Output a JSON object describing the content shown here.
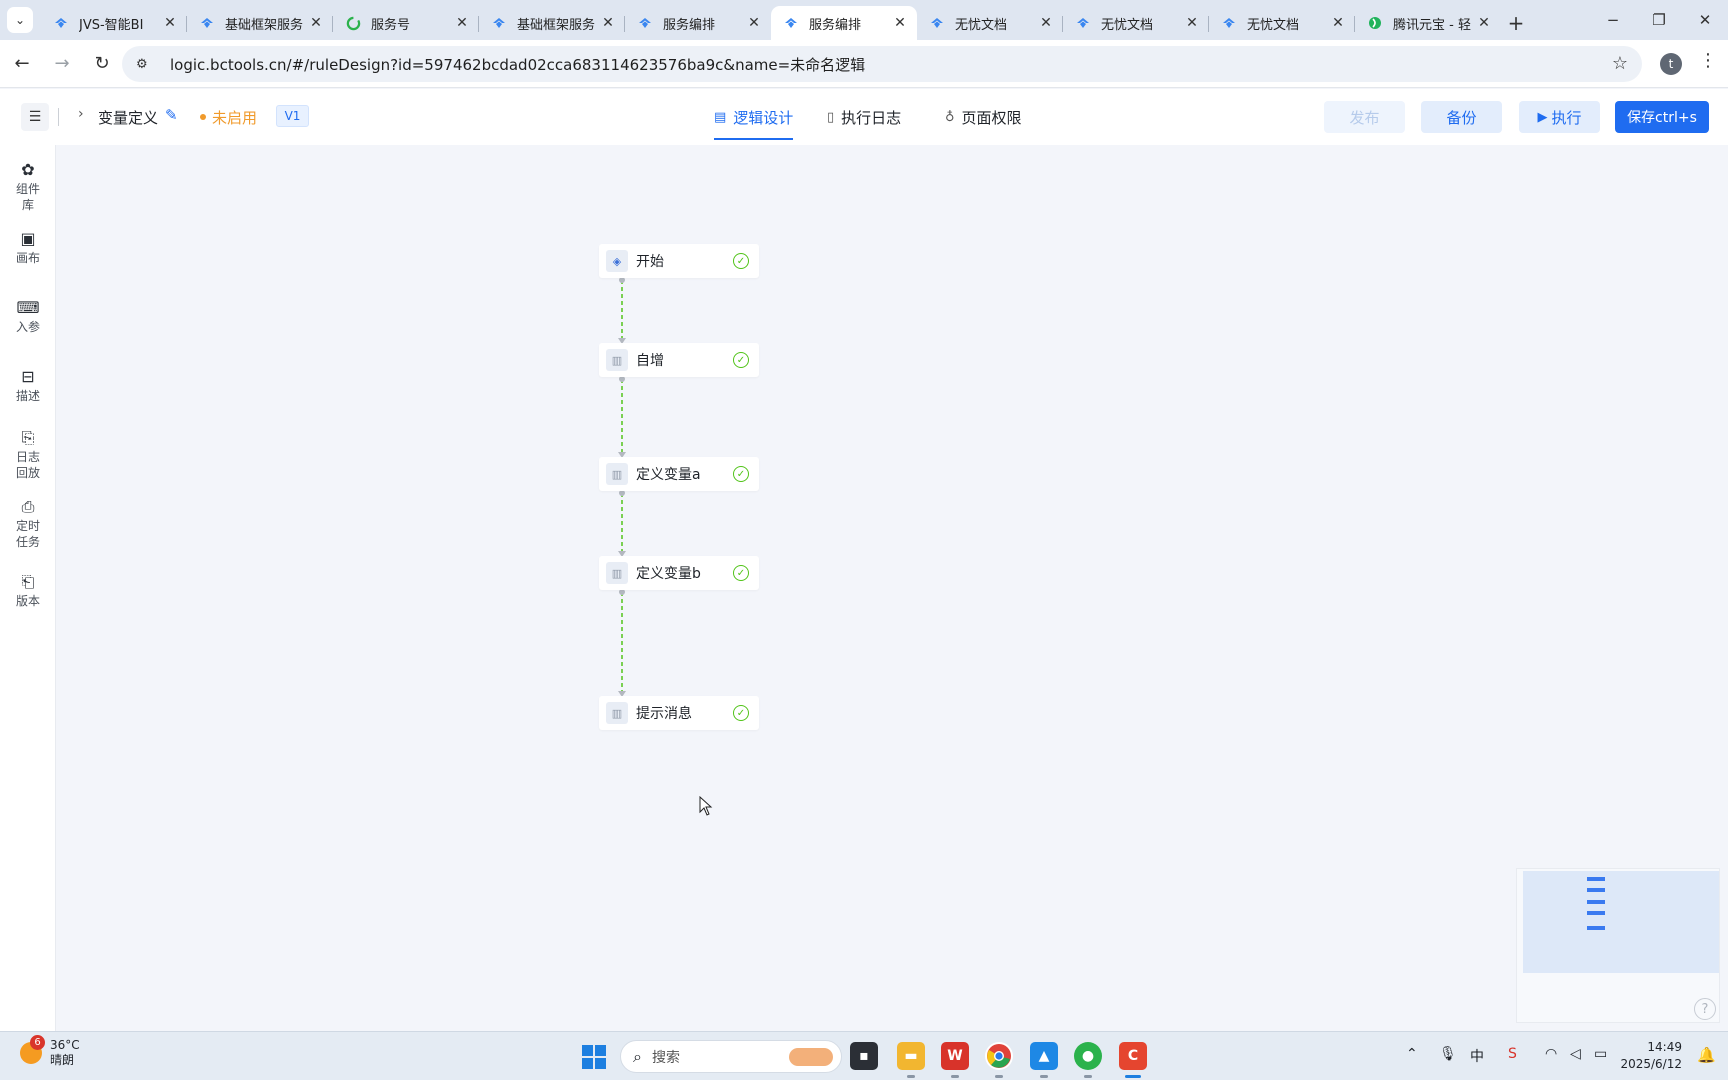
{
  "browser": {
    "tabs": [
      {
        "title": "JVS-智能BI",
        "icon": "jvs-logo-icon",
        "active": false
      },
      {
        "title": "基础框架服务",
        "icon": "jvs-logo-icon",
        "active": false
      },
      {
        "title": "服务号",
        "icon": "wechat-icon",
        "active": false
      },
      {
        "title": "基础框架服务",
        "icon": "jvs-logo-icon",
        "active": false
      },
      {
        "title": "服务编排",
        "icon": "jvs-logo-icon",
        "active": false
      },
      {
        "title": "服务编排",
        "icon": "jvs-logo-icon",
        "active": true
      },
      {
        "title": "无忧文档",
        "icon": "jvs-logo-icon",
        "active": false
      },
      {
        "title": "无忧文档",
        "icon": "jvs-logo-icon",
        "active": false
      },
      {
        "title": "无忧文档",
        "icon": "jvs-logo-icon",
        "active": false
      },
      {
        "title": "腾讯元宝 - 轻",
        "icon": "yuanbao-icon",
        "active": false
      }
    ],
    "url": "logic.bctools.cn/#/ruleDesign?id=597462bcdad02cca683114623576ba9c&name=未命名逻辑",
    "profile_initial": "t"
  },
  "header": {
    "title": "变量定义",
    "status": "未启用",
    "version": "V1",
    "tabs": [
      {
        "label": "逻辑设计",
        "icon": "design-doc-icon",
        "active": true
      },
      {
        "label": "执行日志",
        "icon": "log-doc-icon",
        "active": false
      },
      {
        "label": "页面权限",
        "icon": "key-icon",
        "active": false
      }
    ],
    "buttons": {
      "publish": "发布",
      "backup": "备份",
      "execute": "执行",
      "save": "保存ctrl+s"
    }
  },
  "sidebar": {
    "items": [
      {
        "label": "组件库",
        "icon": "puzzle-icon"
      },
      {
        "label": "画布",
        "icon": "canvas-icon"
      },
      {
        "label": "入参",
        "icon": "code-icon"
      },
      {
        "label": "描述",
        "icon": "text-icon"
      },
      {
        "label": "日志回放",
        "icon": "log-replay-icon"
      },
      {
        "label": "定时任务",
        "icon": "schedule-icon"
      },
      {
        "label": "版本",
        "icon": "version-icon"
      }
    ]
  },
  "flow": {
    "nodes": [
      {
        "label": "开始",
        "type": "start",
        "valid": true
      },
      {
        "label": "自增",
        "type": "step",
        "valid": true
      },
      {
        "label": "定义变量a",
        "type": "step",
        "valid": true
      },
      {
        "label": "定义变量b",
        "type": "step",
        "valid": true
      },
      {
        "label": "提示消息",
        "type": "step",
        "valid": true
      }
    ],
    "edge_color": "#52c41a"
  },
  "taskbar": {
    "weather": {
      "badge": "6",
      "temp": "36°C",
      "cond": "晴朗"
    },
    "search_placeholder": "搜索",
    "ime": "中",
    "time": "14:49",
    "date": "2025/6/12"
  }
}
